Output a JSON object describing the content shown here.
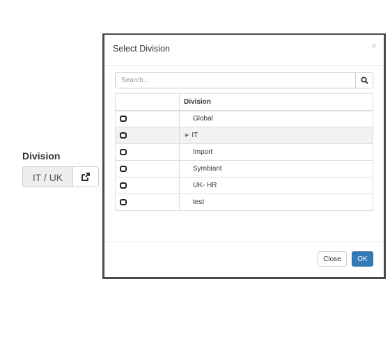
{
  "form": {
    "label": "Division",
    "value": "IT / UK",
    "open_icon": "external-link-icon"
  },
  "modal": {
    "title": "Select Division",
    "close_symbol": "×",
    "search": {
      "placeholder": "Search...",
      "icon": "search-icon"
    },
    "table": {
      "columns": [
        "",
        "Division"
      ],
      "rows": [
        {
          "name": "Global",
          "expandable": false,
          "highlighted": false
        },
        {
          "name": "IT",
          "expandable": true,
          "highlighted": true
        },
        {
          "name": "Import",
          "expandable": false,
          "highlighted": false
        },
        {
          "name": "Symbiant",
          "expandable": false,
          "highlighted": false
        },
        {
          "name": "UK- HR",
          "expandable": false,
          "highlighted": false
        },
        {
          "name": "test",
          "expandable": false,
          "highlighted": false
        }
      ]
    },
    "buttons": {
      "close_label": "Close",
      "ok_label": "OK"
    }
  },
  "colors": {
    "primary": "#337ab7",
    "row_highlight": "#f2f2f2",
    "border": "#dddddd"
  }
}
